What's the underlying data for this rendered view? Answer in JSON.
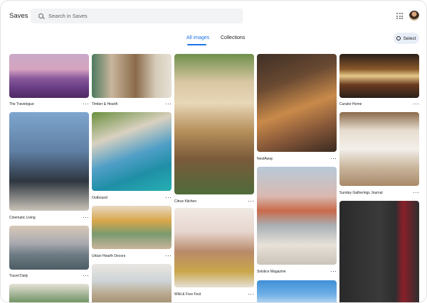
{
  "header": {
    "app_title": "Saves",
    "search_placeholder": "Search in Saves",
    "apps_icon": "apps-grid-icon",
    "avatar": "user-avatar"
  },
  "tabs": [
    {
      "label": "All images",
      "active": true
    },
    {
      "label": "Collections",
      "active": false
    }
  ],
  "toolbar": {
    "select_label": "Select",
    "select_icon": "check-circle-icon"
  },
  "colors": {
    "accent": "#1a73e8",
    "search_bg": "#f1f3f4",
    "select_bg": "#e8eef7"
  },
  "cards": [
    {
      "label": "The Travelogue"
    },
    {
      "label": "Cinematic Living"
    },
    {
      "label": "Travel Daily"
    },
    {
      "label": "Timber & Hearth"
    },
    {
      "label": "Outbound"
    },
    {
      "label": "Urban Hearth Decors"
    },
    {
      "label": "Citrus Kitchen"
    },
    {
      "label": "Wild & Free Fest"
    },
    {
      "label": "NestAway"
    },
    {
      "label": "Solstice Magazine"
    },
    {
      "label": ""
    },
    {
      "label": "Curator Home"
    },
    {
      "label": "Sunday Gatherings Journal"
    },
    {
      "label": ""
    }
  ]
}
